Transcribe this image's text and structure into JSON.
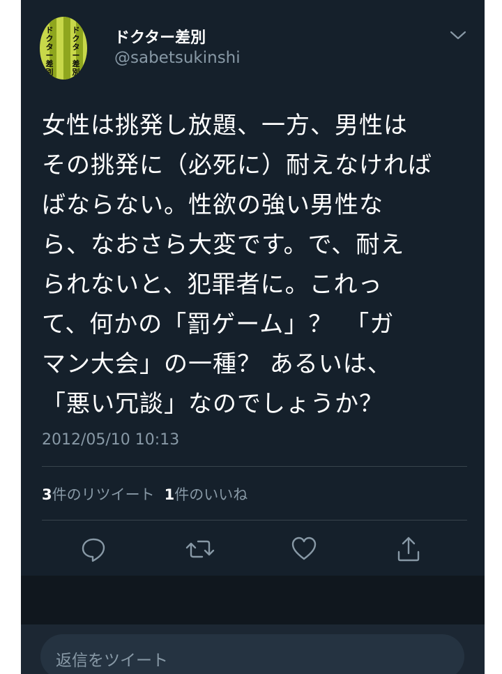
{
  "author": {
    "display_name": "ドクター差別",
    "handle": "@sabetsukinshi",
    "avatar_text_left": "ドクター差別",
    "avatar_text_right": "ドクター差別"
  },
  "tweet": {
    "lines": [
      "女性は挑発し放題、一方、男性は",
      "その挑発に（必死に）耐えなければ",
      "ばならない。性欲の強い男性な",
      "ら、なおさら大変です。で、耐え",
      "られないと、犯罪者に。これっ",
      "て、何かの「罰ゲーム」？　「ガ",
      "マン大会」の一種？ あるいは、",
      "「悪い冗談」なのでしょうか？"
    ],
    "timestamp": "2012/05/10 10:13"
  },
  "stats": {
    "retweet_count": "3",
    "retweet_label": "件のリツイート",
    "like_count": "1",
    "like_label": "件のいいね"
  },
  "actions": [
    "reply-icon",
    "retweet-icon",
    "like-icon",
    "share-icon"
  ],
  "reply": {
    "placeholder": "返信をツイート"
  },
  "colors": {
    "background": "#15202b",
    "text": "#ffffff",
    "muted": "#8899a6"
  }
}
